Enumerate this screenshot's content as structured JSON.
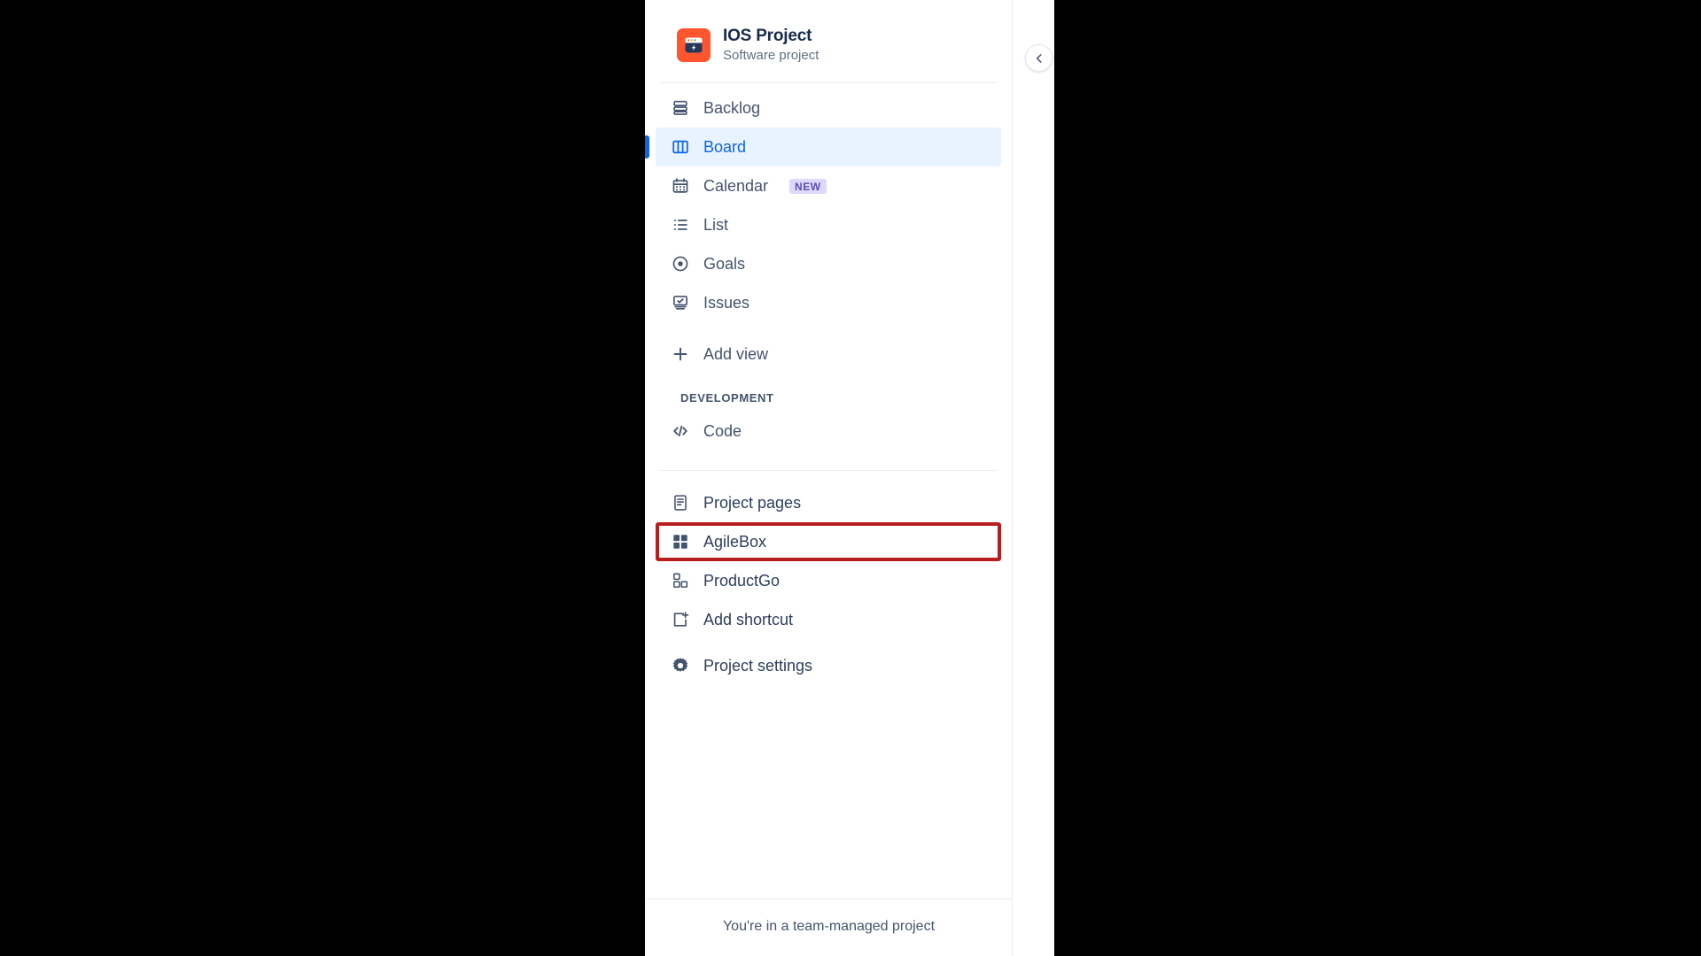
{
  "project": {
    "name": "IOS Project",
    "subtitle": "Software project",
    "icon": "project-avatar-icon",
    "icon_color": "#ff5630"
  },
  "collapse_button": {
    "icon": "chevron-left-icon"
  },
  "nav": {
    "views": [
      {
        "label": "Backlog",
        "icon": "backlog-icon",
        "selected": false
      },
      {
        "label": "Board",
        "icon": "board-icon",
        "selected": true
      },
      {
        "label": "Calendar",
        "icon": "calendar-icon",
        "selected": false,
        "badge": "NEW"
      },
      {
        "label": "List",
        "icon": "list-icon",
        "selected": false
      },
      {
        "label": "Goals",
        "icon": "goals-icon",
        "selected": false
      },
      {
        "label": "Issues",
        "icon": "issues-icon",
        "selected": false
      },
      {
        "label": "Add view",
        "icon": "plus-icon",
        "selected": false
      }
    ],
    "development": {
      "header": "DEVELOPMENT",
      "items": [
        {
          "label": "Code",
          "icon": "code-icon"
        }
      ]
    },
    "shortcuts": [
      {
        "label": "Project pages",
        "icon": "page-icon",
        "annotated": false
      },
      {
        "label": "AgileBox",
        "icon": "grid-four-icon",
        "annotated": true
      },
      {
        "label": "ProductGo",
        "icon": "grid-three-icon",
        "annotated": false
      },
      {
        "label": "Add shortcut",
        "icon": "add-shortcut-icon",
        "annotated": false
      },
      {
        "label": "Project settings",
        "icon": "gear-icon",
        "annotated": false
      }
    ]
  },
  "footer": {
    "note": "You're in a team-managed project"
  },
  "colors": {
    "selected_bg": "#e9f2ff",
    "selected_text": "#0c66e4",
    "badge_bg": "#dfd8fd",
    "badge_text": "#5e4db2",
    "annotation_border": "#b81e1e",
    "text_default": "#44546f"
  }
}
